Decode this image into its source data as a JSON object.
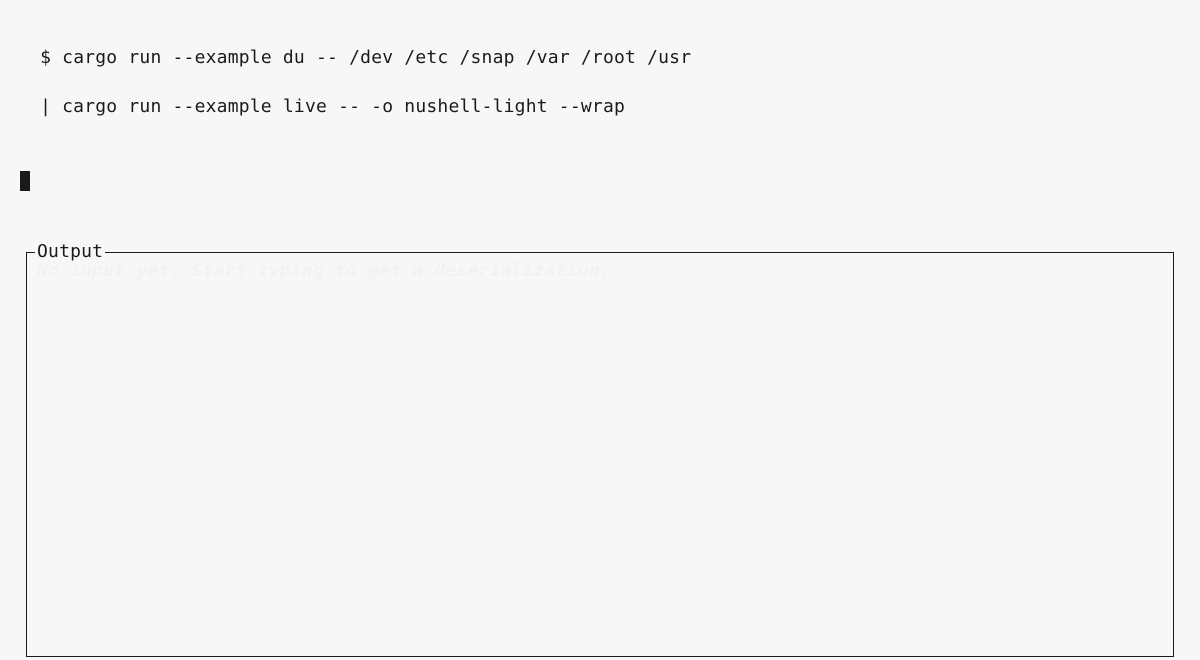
{
  "prompt": {
    "symbol": "$ ",
    "command_line1": "cargo run --example du -- /dev /etc /snap /var /root /usr",
    "command_line2": "  | cargo run --example live -- -o nushell-light --wrap"
  },
  "output": {
    "legend": "Output",
    "placeholder": "No input yet. Start typing to get a deserialization."
  }
}
